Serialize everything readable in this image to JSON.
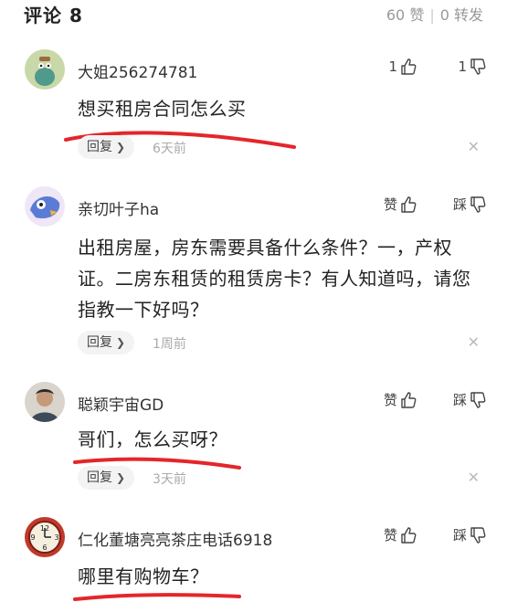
{
  "header": {
    "title": "评论 8",
    "likes": "60 赞",
    "separator": "|",
    "shares": "0 转发"
  },
  "comments": [
    {
      "username": "大姐256274781",
      "like_label": "1",
      "dislike_label": "1",
      "text": "想买租房合同怎么买",
      "reply_label": "回复",
      "time": "6天前"
    },
    {
      "username": "亲切叶子ha",
      "like_label": "赞",
      "dislike_label": "踩",
      "text": "出租房屋，房东需要具备什么条件？一，产权证。二房东租赁的租赁房卡？有人知道吗，请您指教一下好吗？",
      "reply_label": "回复",
      "time": "1周前"
    },
    {
      "username": "聪颖宇宙GD",
      "like_label": "赞",
      "dislike_label": "踩",
      "text": "哥们，怎么买呀？",
      "reply_label": "回复",
      "time": "3天前"
    },
    {
      "username": "仁化董塘亮亮茶庄电话6918",
      "like_label": "赞",
      "dislike_label": "踩",
      "text": "哪里有购物车？"
    }
  ],
  "icons": {
    "like": "thumbs-up-icon",
    "dislike": "thumbs-down-icon",
    "reply_arrow": "chevron-right-icon",
    "close": "close-icon"
  },
  "colors": {
    "underline": "#e4262b",
    "muted": "#999999"
  }
}
